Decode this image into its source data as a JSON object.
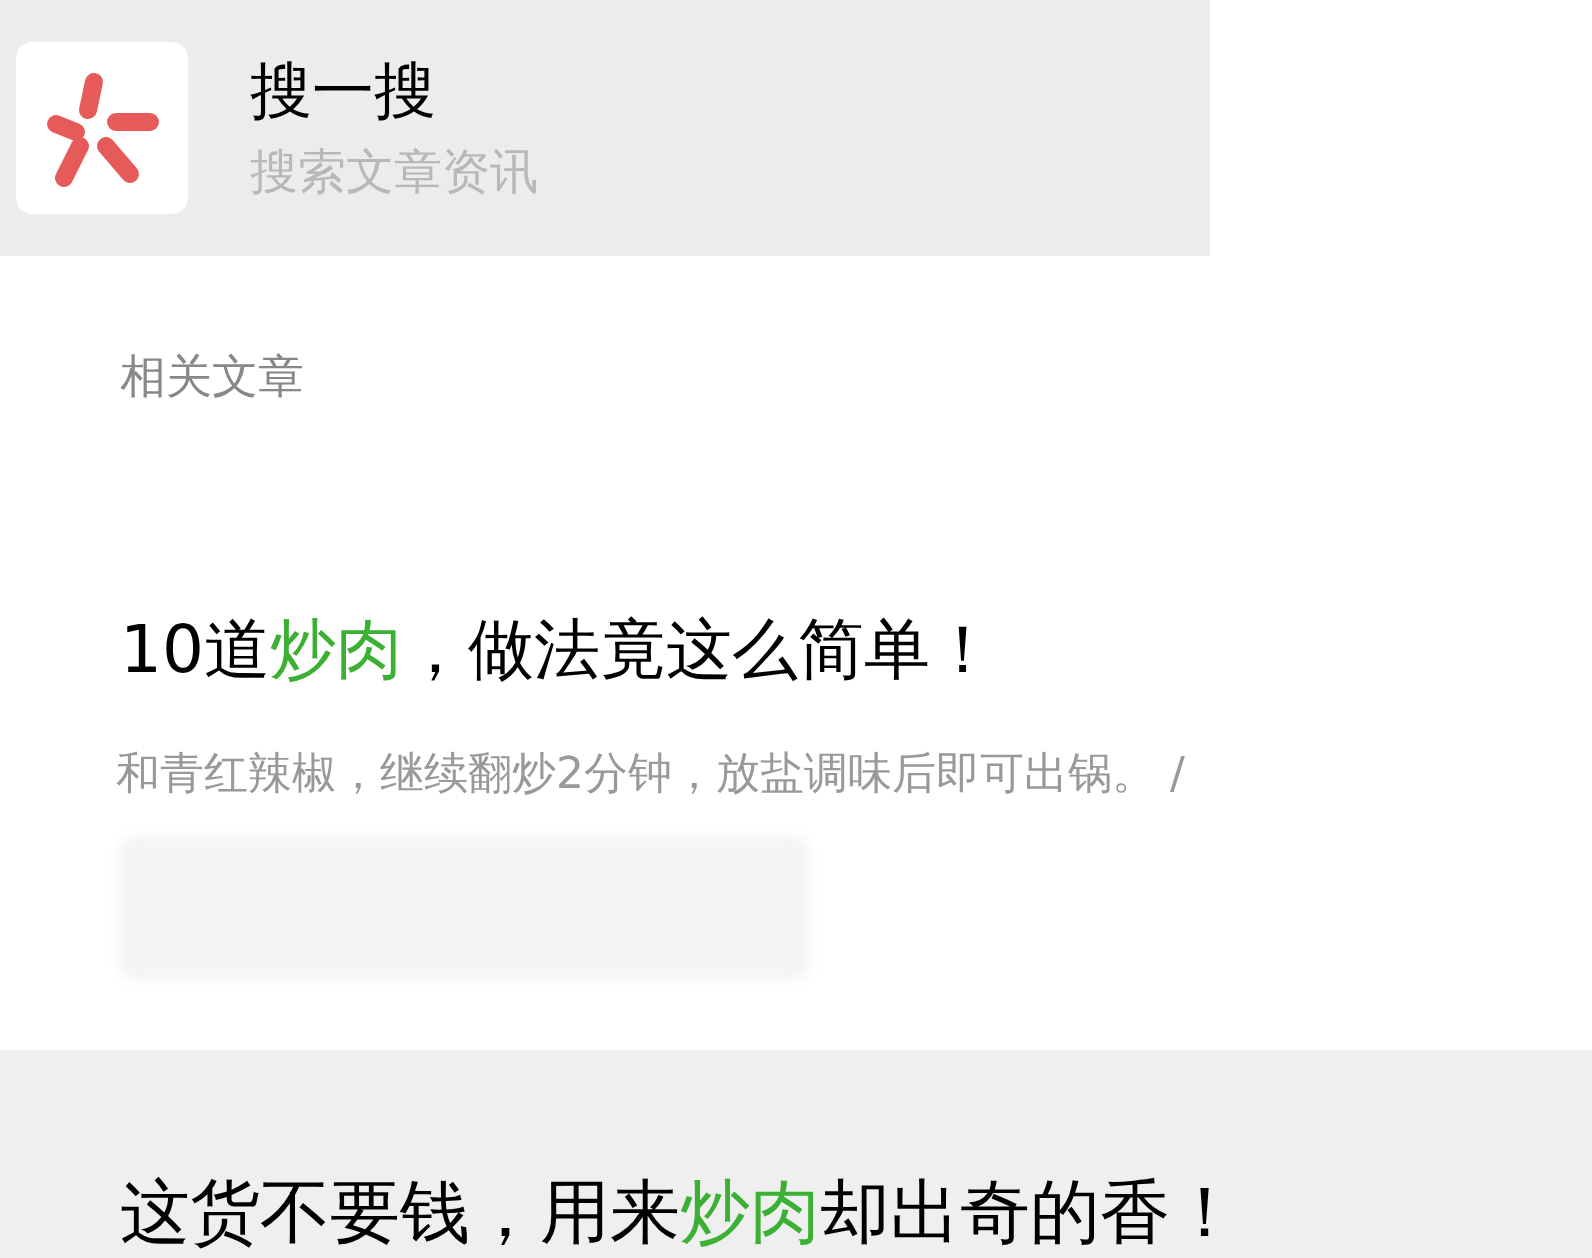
{
  "header": {
    "title": "搜一搜",
    "subtitle": "搜索文章资讯"
  },
  "section_label": "相关文章",
  "articles": [
    {
      "title_parts": [
        {
          "text": "10道",
          "highlight": false
        },
        {
          "text": "炒肉",
          "highlight": true
        },
        {
          "text": "，做法竟这么简单！",
          "highlight": false
        }
      ],
      "snippet": "和青红辣椒，继续翻炒2分钟，放盐调味后即可出锅。 /",
      "source_blurred": true,
      "shaded": false
    },
    {
      "title_parts": [
        {
          "text": "这货不要钱，用来",
          "highlight": false
        },
        {
          "text": "炒肉",
          "highlight": true
        },
        {
          "text": "却出奇的香！",
          "highlight": false
        }
      ],
      "shaded": true
    }
  ]
}
